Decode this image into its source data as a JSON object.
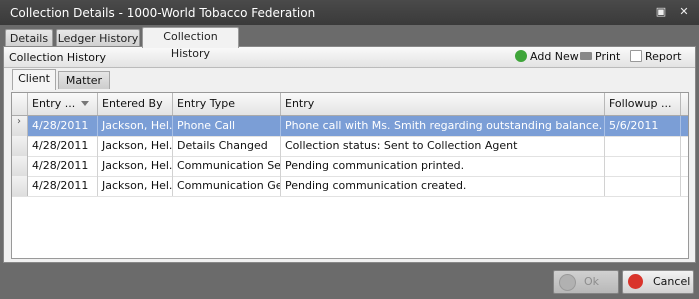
{
  "window": {
    "title": "Collection Details - 1000-World Tobacco Federation",
    "minimize_glyph": "▣",
    "close_glyph": "✕"
  },
  "tabs": [
    {
      "label": "Details"
    },
    {
      "label": "Ledger History"
    },
    {
      "label": "Collection History",
      "active": true
    }
  ],
  "panel": {
    "title": "Collection History",
    "toolbar": {
      "add_new": "Add New",
      "print": "Print",
      "report": "Report"
    }
  },
  "subtabs": [
    {
      "label": "Client",
      "active": true
    },
    {
      "label": "Matter"
    }
  ],
  "grid": {
    "columns": [
      "Entry ...",
      "Entered By",
      "Entry Type",
      "Entry",
      "Followup ..."
    ],
    "rows": [
      {
        "date": "4/28/2011",
        "by": "Jackson, Hel...",
        "type": "Phone Call",
        "entry": "Phone call with Ms. Smith regarding outstanding balance.  Will follow ...",
        "followup": "5/6/2011",
        "selected": true
      },
      {
        "date": "4/28/2011",
        "by": "Jackson, Hel...",
        "type": "Details Changed",
        "entry": "Collection status: Sent to Collection Agent",
        "followup": ""
      },
      {
        "date": "4/28/2011",
        "by": "Jackson, Hel...",
        "type": "Communication Sent",
        "entry": "Pending communication printed.",
        "followup": ""
      },
      {
        "date": "4/28/2011",
        "by": "Jackson, Hel...",
        "type": "Communication Gen...",
        "entry": "Pending communication created.",
        "followup": ""
      }
    ]
  },
  "footer": {
    "ok_label": "Ok",
    "cancel_label": "Cancel"
  },
  "colors": {
    "selection": "#7b9ed6",
    "add_icon": "#3fa53a",
    "cancel_icon": "#d9342b"
  }
}
